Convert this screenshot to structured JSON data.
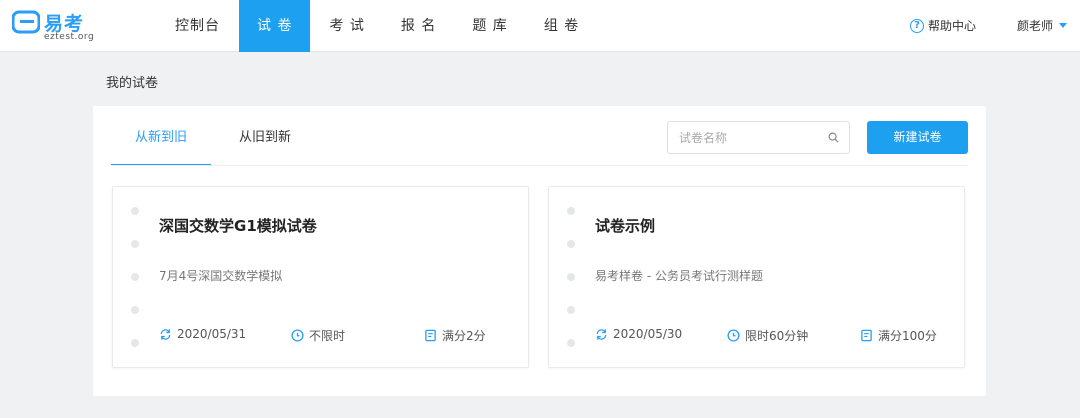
{
  "logo": {
    "brand": "易考",
    "domain": "eztest.org"
  },
  "nav": {
    "items": [
      "控制台",
      "试 卷",
      "考 试",
      "报 名",
      "题 库",
      "组 卷"
    ],
    "active_index": 1
  },
  "header": {
    "help": "帮助中心",
    "user": "颜老师"
  },
  "page": {
    "title": "我的试卷"
  },
  "tabs": [
    "从新到旧",
    "从旧到新"
  ],
  "search": {
    "placeholder": "试卷名称"
  },
  "new_button": "新建试卷",
  "cards": [
    {
      "title": "深国交数学G1模拟试卷",
      "desc": "7月4号深国交数学模拟",
      "date": "2020/05/31",
      "time_limit": "不限时",
      "score": "满分2分"
    },
    {
      "title": "试卷示例",
      "desc": "易考样卷 - 公务员考试行测样题",
      "date": "2020/05/30",
      "time_limit": "限时60分钟",
      "score": "满分100分"
    }
  ],
  "colors": {
    "accent": "#1ea0f0",
    "background": "#f0f1f3"
  }
}
